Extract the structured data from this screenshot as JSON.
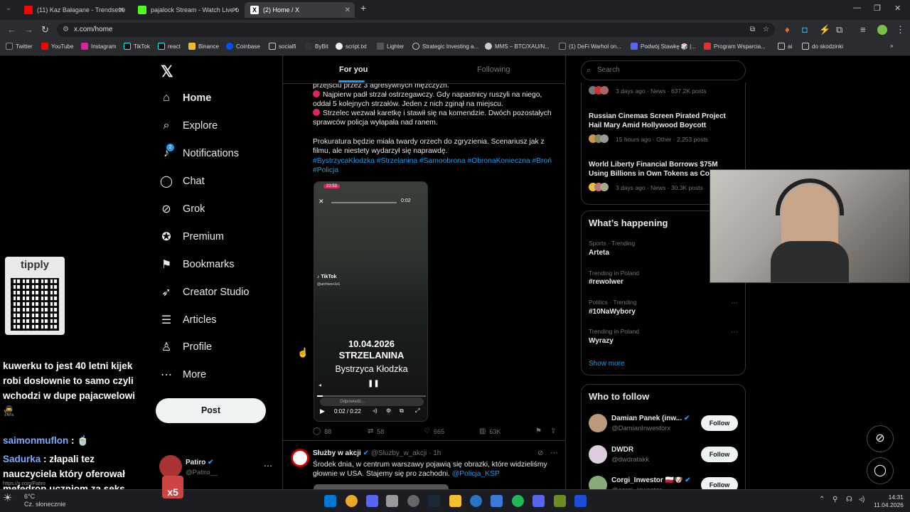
{
  "browser": {
    "tabs": [
      {
        "label": "(11) Kaz Bałagane - Trendsette",
        "color": "#ff0000"
      },
      {
        "label": "pajalock Stream - Watch Live o",
        "color": "#53fc18"
      },
      {
        "label": "(2) Home / X",
        "color": "#ffffff"
      }
    ],
    "url": "x.com/home",
    "bookmarks": [
      "Twitter",
      "YouTube",
      "Instagram",
      "TikTok",
      "react",
      "Binance",
      "Coinbase",
      "socialfi",
      "ByBit",
      "script.txt",
      "Lighter",
      "Strategic Investing a...",
      "MMS – BTC/XAU/N...",
      "(1) DeFi Warhol on...",
      "Podwój Stawkę 🎲 |...",
      "Program Wsparcia...",
      "ai",
      "do skodzinki"
    ]
  },
  "overlay": {
    "tipply_title": "tipply",
    "chat": [
      {
        "user": "",
        "text": "kuwerku to jest 40 letni kijek robi dosłownie to samo czyli wchodzi w dupe pajacwelowi 🥷"
      },
      {
        "user": "saimonmuflon",
        "text": " : 🍵"
      },
      {
        "user": "Sadurka",
        "text": " : złapali tez nauczyciela który oferował mefedron uczniom za seks"
      }
    ]
  },
  "x": {
    "nav": [
      {
        "label": "Home",
        "icon": "home-icon",
        "glyph": "⌂"
      },
      {
        "label": "Explore",
        "icon": "search-icon",
        "glyph": "⌕"
      },
      {
        "label": "Notifications",
        "icon": "bell-icon",
        "glyph": "♪"
      },
      {
        "label": "Chat",
        "icon": "chat-icon",
        "glyph": "◯"
      },
      {
        "label": "Grok",
        "icon": "grok-icon",
        "glyph": "⊘"
      },
      {
        "label": "Premium",
        "icon": "premium-icon",
        "glyph": "✪"
      },
      {
        "label": "Bookmarks",
        "icon": "bookmark-icon",
        "glyph": "⚑"
      },
      {
        "label": "Creator Studio",
        "icon": "rocket-icon",
        "glyph": "➶"
      },
      {
        "label": "Articles",
        "icon": "articles-icon",
        "glyph": "☰"
      },
      {
        "label": "Profile",
        "icon": "profile-icon",
        "glyph": "♙"
      },
      {
        "label": "More",
        "icon": "more-icon",
        "glyph": "⋯"
      }
    ],
    "notifications_badge": "2",
    "post_label": "Post",
    "account": {
      "name": "Patiro",
      "handle": "@Patiro__"
    },
    "tabs": {
      "for_you": "For you",
      "following": "Following"
    },
    "tweet1": {
      "line0": "przejściu przez 3 agresywnych mężczyzn.",
      "p1": "Najpierw padł strzał ostrzegawczy. Gdy napastnicy ruszyli na niego, oddał 5 kolejnych strzałów. Jeden z nich zginął na miejscu.",
      "p2": "Strzelec wezwał karetkę i stawił się na komendzie. Dwóch pozostałych sprawców policja wyłapała nad ranem.",
      "p3": "Prokuratura będzie miała twardy orzech do zgryzienia. Scenariusz jak z filmu, ale niestety wydarzył się naprawdę.",
      "hashtags1": "#BystrzycaKłodzka #Strzelanina #Samoobrona #ObronaKonieczna #Broń",
      "hashtags2": "#Policja",
      "video": {
        "status_time": "22:53",
        "progress_small": "0:02",
        "tiktok": "TikTok",
        "tiktok_handle": "@archiveo1o1",
        "date": "10.04.2026",
        "title": "STRZELANINA",
        "place": "Bystrzyca Kłodzka",
        "reply": "Odpowiedz...",
        "time": "0:02 / 0:22"
      },
      "replies": "88",
      "reposts": "58",
      "likes": "665",
      "views": "63K"
    },
    "tweet2": {
      "name": "Służby w akcji",
      "handle": "@Sluzby_w_akcji",
      "time": "1h",
      "text": "Środek dnia, w centrum warszawy pojawią się obrazki, które widzieliśmy głownie w USA. Stajemy się pro zachodni.",
      "mention": "@Policja_KSP"
    },
    "search_placeholder": "Search",
    "news": [
      {
        "title": "",
        "meta": "3 days ago · News · 637.2K posts"
      },
      {
        "title": "Russian Cinemas Screen Pirated Project Hail Mary Amid Hollywood Boycott",
        "meta": "15 hours ago · Other · 2,253 posts"
      },
      {
        "title": "World Liberty Financial Borrows $75M Using Billions in Own Tokens as Coll",
        "meta": "3 days ago · News · 30.3K posts"
      }
    ],
    "happening_title": "What’s happening",
    "trends": [
      {
        "context": "Sports · Trending",
        "name": "Arteta"
      },
      {
        "context": "Trending in Poland",
        "name": "#rewolwer"
      },
      {
        "context": "Politics · Trending",
        "name": "#10NaWybory"
      },
      {
        "context": "Trending in Poland",
        "name": "Wyrazy"
      }
    ],
    "show_more": "Show more",
    "who_to_follow_title": "Who to follow",
    "follow_suggestions": [
      {
        "name": "Damian Panek (inw...",
        "handle": "@DamianInwestorx"
      },
      {
        "name": "DWDR",
        "handle": "@dwdratakk"
      },
      {
        "name": "Corgi_Inwestor 🇵🇱🐶",
        "handle": "@corgi_inwestor"
      }
    ],
    "follow_label": "Follow"
  },
  "taskbar": {
    "weather_temp": "6°C",
    "weather_desc": "Cz. słonecznie",
    "time": "14:31",
    "date": "11.04.2026",
    "status_url": "https://x.com/Patiro"
  },
  "colors": {
    "accent": "#1d9bf0",
    "background": "#000000",
    "border": "#2f3336"
  }
}
